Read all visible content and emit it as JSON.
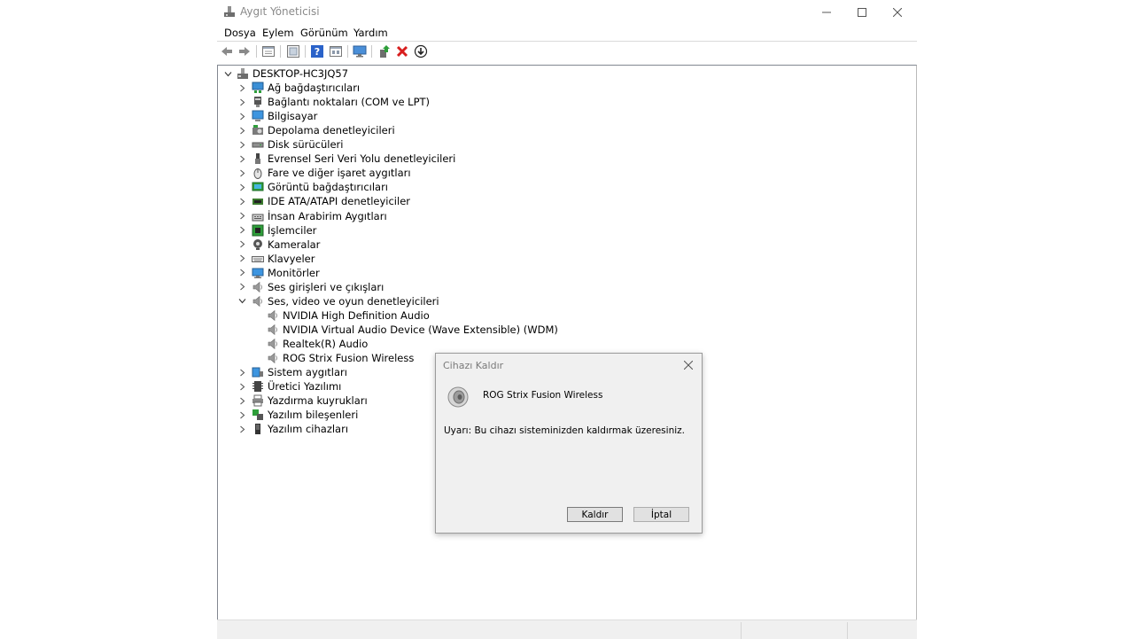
{
  "window": {
    "title": "Aygıt Yöneticisi"
  },
  "menu": [
    "Dosya",
    "Eylem",
    "Görünüm",
    "Yardım"
  ],
  "toolbar": {
    "buttons": [
      "back-icon",
      "forward-icon",
      "properties-icon",
      "update-view-icon",
      "help-icon",
      "show-hidden-icon",
      "monitor-icon",
      "update-driver-icon",
      "uninstall-icon",
      "disable-icon"
    ],
    "accent_colors": {
      "help": "#2a62c9",
      "update_driver": "#2e9e3a",
      "uninstall": "#d81e1e"
    }
  },
  "tree": {
    "root": "DESKTOP-HC3JQ57",
    "items": [
      {
        "label": "Ağ bağdaştırıcıları",
        "icon": "network-adapter-icon"
      },
      {
        "label": "Bağlantı noktaları (COM ve LPT)",
        "icon": "port-icon"
      },
      {
        "label": "Bilgisayar",
        "icon": "computer-icon"
      },
      {
        "label": "Depolama denetleyicileri",
        "icon": "storage-controller-icon"
      },
      {
        "label": "Disk sürücüleri",
        "icon": "disk-drive-icon"
      },
      {
        "label": "Evrensel Seri Veri Yolu denetleyicileri",
        "icon": "usb-icon"
      },
      {
        "label": "Fare ve diğer işaret aygıtları",
        "icon": "mouse-icon"
      },
      {
        "label": "Görüntü bağdaştırıcıları",
        "icon": "display-adapter-icon"
      },
      {
        "label": "IDE ATA/ATAPI denetleyiciler",
        "icon": "ide-controller-icon"
      },
      {
        "label": "İnsan Arabirim Aygıtları",
        "icon": "hid-icon"
      },
      {
        "label": "İşlemciler",
        "icon": "processor-icon"
      },
      {
        "label": "Kameralar",
        "icon": "camera-icon"
      },
      {
        "label": "Klavyeler",
        "icon": "keyboard-icon"
      },
      {
        "label": "Monitörler",
        "icon": "monitor-icon"
      },
      {
        "label": "Ses girişleri ve çıkışları",
        "icon": "speaker-icon"
      },
      {
        "label": "Ses, video ve oyun denetleyicileri",
        "icon": "speaker-icon",
        "expanded": true,
        "children": [
          {
            "label": "NVIDIA High Definition Audio",
            "icon": "speaker-icon"
          },
          {
            "label": "NVIDIA Virtual Audio Device (Wave Extensible) (WDM)",
            "icon": "speaker-icon"
          },
          {
            "label": "Realtek(R) Audio",
            "icon": "speaker-icon"
          },
          {
            "label": "ROG Strix Fusion Wireless",
            "icon": "speaker-icon"
          }
        ]
      },
      {
        "label": "Sistem aygıtları",
        "icon": "system-device-icon"
      },
      {
        "label": "Üretici Yazılımı",
        "icon": "firmware-icon"
      },
      {
        "label": "Yazdırma kuyrukları",
        "icon": "printer-icon"
      },
      {
        "label": "Yazılım bileşenleri",
        "icon": "software-component-icon"
      },
      {
        "label": "Yazılım cihazları",
        "icon": "software-device-icon"
      }
    ]
  },
  "dialog": {
    "title": "Cihazı Kaldır",
    "device_name": "ROG Strix Fusion Wireless",
    "warning": "Uyarı: Bu cihazı sisteminizden kaldırmak üzeresiniz.",
    "remove_label": "Kaldır",
    "cancel_label": "İptal"
  }
}
